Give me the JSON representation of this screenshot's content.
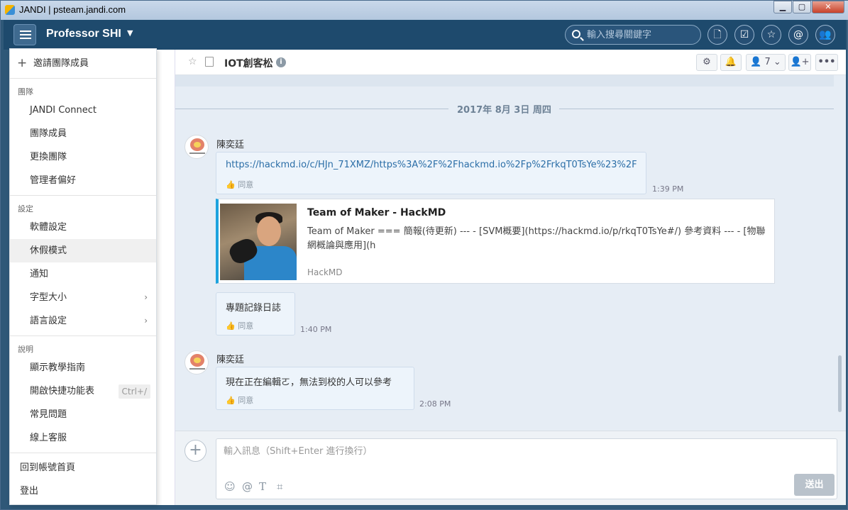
{
  "window": {
    "title": "JANDI | psteam.jandi.com",
    "min_glyph": "▁",
    "max_glyph": "▢",
    "close_glyph": "✕"
  },
  "header": {
    "team_name": "Professor SHI",
    "search_placeholder": "輸入搜尋關鍵字",
    "icons": [
      "file-icon",
      "calendar-check-icon",
      "star-icon",
      "mention-icon",
      "members-icon"
    ]
  },
  "menu": {
    "invite": "邀請團隊成員",
    "sections": {
      "team": "團隊",
      "settings": "設定",
      "help": "說明"
    },
    "team_items": [
      "JANDI Connect",
      "團隊成員",
      "更換團隊",
      "管理者偏好"
    ],
    "settings_items": [
      "軟體設定",
      "休假模式",
      "通知",
      "字型大小",
      "語言設定"
    ],
    "help_items": [
      "顯示教學指南",
      "開啟快捷功能表",
      "常見問題",
      "線上客服"
    ],
    "shortcut": "Ctrl+/",
    "footer_items": [
      "回到帳號首頁",
      "登出"
    ]
  },
  "topic": {
    "name": "IOT創客松",
    "member_count": "7"
  },
  "messages": {
    "date": "2017年 8月 3日 周四",
    "user1": "陳奕廷",
    "msg1_link": "https://hackmd.io/c/HJn_71XMZ/https%3A%2F%2Fhackmd.io%2Fp%2FrkqT0TsYe%23%2F",
    "like_label": "同意",
    "msg1_time": "1:39 PM",
    "card": {
      "title": "Team of Maker - HackMD",
      "desc": "Team of Maker === 簡報(待更新) --- - [SVM概要](https://hackmd.io/p/rkqT0TsYe#/) 參考資料 --- - [物聯網概論與應用](h",
      "source": "HackMD"
    },
    "msg2_text": "專題記錄日誌",
    "msg2_time": "1:40 PM",
    "user2": "陳奕廷",
    "msg3_text": "現在正在編輯ㄛ，無法到校的人可以參考",
    "msg3_time": "2:08 PM"
  },
  "composer": {
    "placeholder": "輸入訊息（Shift+Enter 進行換行）",
    "send_label": "送出"
  }
}
